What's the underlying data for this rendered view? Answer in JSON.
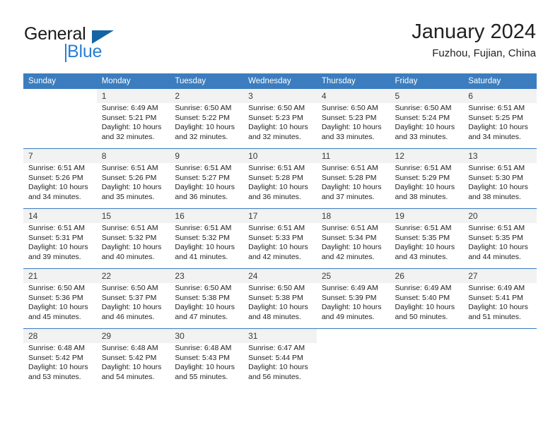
{
  "brand": {
    "name_part1": "General",
    "name_part2": "Blue",
    "accent_color": "#2a7fd4",
    "triangle_color": "#1464a5"
  },
  "header": {
    "title": "January 2024",
    "subtitle": "Fuzhou, Fujian, China"
  },
  "theme": {
    "header_row_bg": "#3b7dbf",
    "daynum_bg": "#f2f2f2",
    "divider": "#3b7dbf"
  },
  "weekdays": [
    "Sunday",
    "Monday",
    "Tuesday",
    "Wednesday",
    "Thursday",
    "Friday",
    "Saturday"
  ],
  "weeks": [
    [
      {
        "day": "",
        "sunrise": "",
        "sunset": "",
        "daylight1": "",
        "daylight2": "",
        "empty": true
      },
      {
        "day": "1",
        "sunrise": "Sunrise: 6:49 AM",
        "sunset": "Sunset: 5:21 PM",
        "daylight1": "Daylight: 10 hours",
        "daylight2": "and 32 minutes."
      },
      {
        "day": "2",
        "sunrise": "Sunrise: 6:50 AM",
        "sunset": "Sunset: 5:22 PM",
        "daylight1": "Daylight: 10 hours",
        "daylight2": "and 32 minutes."
      },
      {
        "day": "3",
        "sunrise": "Sunrise: 6:50 AM",
        "sunset": "Sunset: 5:23 PM",
        "daylight1": "Daylight: 10 hours",
        "daylight2": "and 32 minutes."
      },
      {
        "day": "4",
        "sunrise": "Sunrise: 6:50 AM",
        "sunset": "Sunset: 5:23 PM",
        "daylight1": "Daylight: 10 hours",
        "daylight2": "and 33 minutes."
      },
      {
        "day": "5",
        "sunrise": "Sunrise: 6:50 AM",
        "sunset": "Sunset: 5:24 PM",
        "daylight1": "Daylight: 10 hours",
        "daylight2": "and 33 minutes."
      },
      {
        "day": "6",
        "sunrise": "Sunrise: 6:51 AM",
        "sunset": "Sunset: 5:25 PM",
        "daylight1": "Daylight: 10 hours",
        "daylight2": "and 34 minutes."
      }
    ],
    [
      {
        "day": "7",
        "sunrise": "Sunrise: 6:51 AM",
        "sunset": "Sunset: 5:26 PM",
        "daylight1": "Daylight: 10 hours",
        "daylight2": "and 34 minutes."
      },
      {
        "day": "8",
        "sunrise": "Sunrise: 6:51 AM",
        "sunset": "Sunset: 5:26 PM",
        "daylight1": "Daylight: 10 hours",
        "daylight2": "and 35 minutes."
      },
      {
        "day": "9",
        "sunrise": "Sunrise: 6:51 AM",
        "sunset": "Sunset: 5:27 PM",
        "daylight1": "Daylight: 10 hours",
        "daylight2": "and 36 minutes."
      },
      {
        "day": "10",
        "sunrise": "Sunrise: 6:51 AM",
        "sunset": "Sunset: 5:28 PM",
        "daylight1": "Daylight: 10 hours",
        "daylight2": "and 36 minutes."
      },
      {
        "day": "11",
        "sunrise": "Sunrise: 6:51 AM",
        "sunset": "Sunset: 5:28 PM",
        "daylight1": "Daylight: 10 hours",
        "daylight2": "and 37 minutes."
      },
      {
        "day": "12",
        "sunrise": "Sunrise: 6:51 AM",
        "sunset": "Sunset: 5:29 PM",
        "daylight1": "Daylight: 10 hours",
        "daylight2": "and 38 minutes."
      },
      {
        "day": "13",
        "sunrise": "Sunrise: 6:51 AM",
        "sunset": "Sunset: 5:30 PM",
        "daylight1": "Daylight: 10 hours",
        "daylight2": "and 38 minutes."
      }
    ],
    [
      {
        "day": "14",
        "sunrise": "Sunrise: 6:51 AM",
        "sunset": "Sunset: 5:31 PM",
        "daylight1": "Daylight: 10 hours",
        "daylight2": "and 39 minutes."
      },
      {
        "day": "15",
        "sunrise": "Sunrise: 6:51 AM",
        "sunset": "Sunset: 5:32 PM",
        "daylight1": "Daylight: 10 hours",
        "daylight2": "and 40 minutes."
      },
      {
        "day": "16",
        "sunrise": "Sunrise: 6:51 AM",
        "sunset": "Sunset: 5:32 PM",
        "daylight1": "Daylight: 10 hours",
        "daylight2": "and 41 minutes."
      },
      {
        "day": "17",
        "sunrise": "Sunrise: 6:51 AM",
        "sunset": "Sunset: 5:33 PM",
        "daylight1": "Daylight: 10 hours",
        "daylight2": "and 42 minutes."
      },
      {
        "day": "18",
        "sunrise": "Sunrise: 6:51 AM",
        "sunset": "Sunset: 5:34 PM",
        "daylight1": "Daylight: 10 hours",
        "daylight2": "and 42 minutes."
      },
      {
        "day": "19",
        "sunrise": "Sunrise: 6:51 AM",
        "sunset": "Sunset: 5:35 PM",
        "daylight1": "Daylight: 10 hours",
        "daylight2": "and 43 minutes."
      },
      {
        "day": "20",
        "sunrise": "Sunrise: 6:51 AM",
        "sunset": "Sunset: 5:35 PM",
        "daylight1": "Daylight: 10 hours",
        "daylight2": "and 44 minutes."
      }
    ],
    [
      {
        "day": "21",
        "sunrise": "Sunrise: 6:50 AM",
        "sunset": "Sunset: 5:36 PM",
        "daylight1": "Daylight: 10 hours",
        "daylight2": "and 45 minutes."
      },
      {
        "day": "22",
        "sunrise": "Sunrise: 6:50 AM",
        "sunset": "Sunset: 5:37 PM",
        "daylight1": "Daylight: 10 hours",
        "daylight2": "and 46 minutes."
      },
      {
        "day": "23",
        "sunrise": "Sunrise: 6:50 AM",
        "sunset": "Sunset: 5:38 PM",
        "daylight1": "Daylight: 10 hours",
        "daylight2": "and 47 minutes."
      },
      {
        "day": "24",
        "sunrise": "Sunrise: 6:50 AM",
        "sunset": "Sunset: 5:38 PM",
        "daylight1": "Daylight: 10 hours",
        "daylight2": "and 48 minutes."
      },
      {
        "day": "25",
        "sunrise": "Sunrise: 6:49 AM",
        "sunset": "Sunset: 5:39 PM",
        "daylight1": "Daylight: 10 hours",
        "daylight2": "and 49 minutes."
      },
      {
        "day": "26",
        "sunrise": "Sunrise: 6:49 AM",
        "sunset": "Sunset: 5:40 PM",
        "daylight1": "Daylight: 10 hours",
        "daylight2": "and 50 minutes."
      },
      {
        "day": "27",
        "sunrise": "Sunrise: 6:49 AM",
        "sunset": "Sunset: 5:41 PM",
        "daylight1": "Daylight: 10 hours",
        "daylight2": "and 51 minutes."
      }
    ],
    [
      {
        "day": "28",
        "sunrise": "Sunrise: 6:48 AM",
        "sunset": "Sunset: 5:42 PM",
        "daylight1": "Daylight: 10 hours",
        "daylight2": "and 53 minutes."
      },
      {
        "day": "29",
        "sunrise": "Sunrise: 6:48 AM",
        "sunset": "Sunset: 5:42 PM",
        "daylight1": "Daylight: 10 hours",
        "daylight2": "and 54 minutes."
      },
      {
        "day": "30",
        "sunrise": "Sunrise: 6:48 AM",
        "sunset": "Sunset: 5:43 PM",
        "daylight1": "Daylight: 10 hours",
        "daylight2": "and 55 minutes."
      },
      {
        "day": "31",
        "sunrise": "Sunrise: 6:47 AM",
        "sunset": "Sunset: 5:44 PM",
        "daylight1": "Daylight: 10 hours",
        "daylight2": "and 56 minutes."
      },
      {
        "day": "",
        "sunrise": "",
        "sunset": "",
        "daylight1": "",
        "daylight2": "",
        "empty": true
      },
      {
        "day": "",
        "sunrise": "",
        "sunset": "",
        "daylight1": "",
        "daylight2": "",
        "empty": true
      },
      {
        "day": "",
        "sunrise": "",
        "sunset": "",
        "daylight1": "",
        "daylight2": "",
        "empty": true
      }
    ]
  ]
}
